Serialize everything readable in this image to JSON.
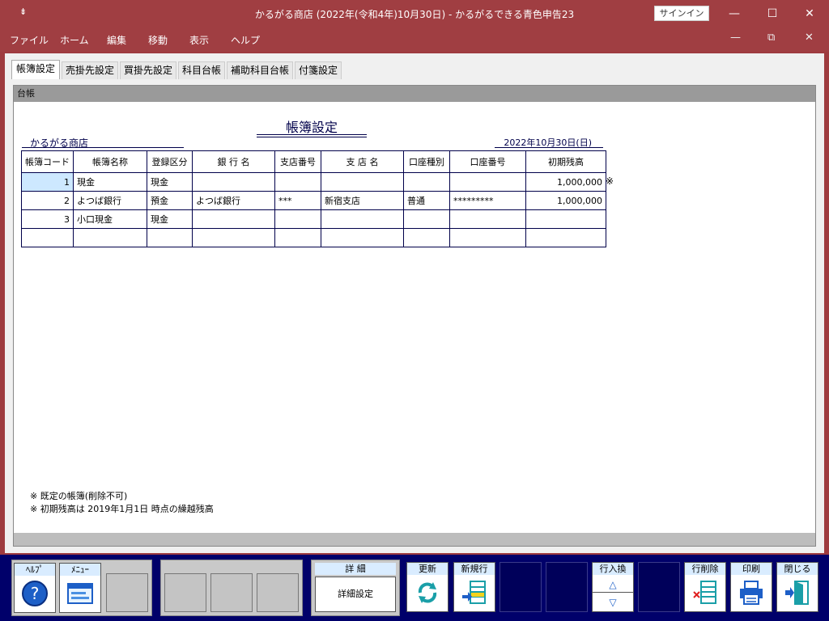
{
  "window": {
    "title": "かるがる商店 (2022年(令和4年)10月30日)  -  かるがるできる青色申告23",
    "sys_menu_glyph": "⇟",
    "signin": "サインイン"
  },
  "menu": [
    "ファイル",
    "ホーム",
    "編集",
    "移動",
    "表示",
    "ヘルプ"
  ],
  "tabs": [
    "帳簿設定",
    "売掛先設定",
    "買掛先設定",
    "科目台帳",
    "補助科目台帳",
    "付箋設定"
  ],
  "panel": {
    "header": "台帳",
    "doc_title": "帳簿設定",
    "company": "かるがる商店",
    "date": "2022年10月30日(日)"
  },
  "table": {
    "headers": [
      "帳簿コード",
      "帳簿名称",
      "登録区分",
      "銀 行 名",
      "支店番号",
      "支 店 名",
      "口座種別",
      "口座番号",
      "初期残高"
    ],
    "rows": [
      [
        "1",
        "現金",
        "現金",
        "",
        "",
        "",
        "",
        "",
        "1,000,000"
      ],
      [
        "2",
        "よつば銀行",
        "預金",
        "よつば銀行",
        "***",
        "新宿支店",
        "普通",
        "*********",
        "1,000,000"
      ],
      [
        "3",
        "小口現金",
        "現金",
        "",
        "",
        "",
        "",
        "",
        ""
      ],
      [
        "",
        "",
        "",
        "",
        "",
        "",
        "",
        "",
        ""
      ]
    ],
    "row_mark": "※"
  },
  "notes": [
    "※ 既定の帳簿(削除不可)",
    "※ 初期残高は 2019年1月1日 時点の繰越残高"
  ],
  "toolbar": {
    "help": "ﾍﾙﾌﾟ",
    "menu": "ﾒﾆｭｰ",
    "detail_header": "詳 細",
    "detail_button": "詳細設定",
    "update": "更新",
    "new_row": "新規行",
    "row_swap": "行入換",
    "delete_row": "行削除",
    "print": "印刷",
    "close": "閉じる"
  },
  "colors": {
    "titlebar": "#a03e42",
    "toolbar": "#00006a",
    "ink": "#00004a",
    "selection": "#cde8ff"
  }
}
